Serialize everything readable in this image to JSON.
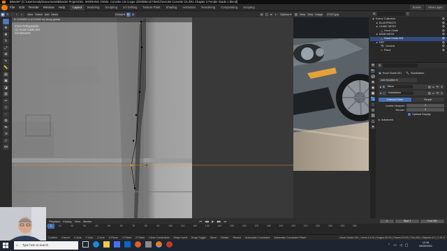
{
  "window": {
    "title": "Blender* [C:\\Users\\Andy\\Documents\\Blender Projects\\01. WORKING ON\\25. Corvette C6 Coupe 2004\\Blend Files\\Chevrolet Corvette C6 ZR1 Chapter 3 Fender Guide A.blend]"
  },
  "menubar": {
    "menus": [
      "File",
      "Edit",
      "Render",
      "Window",
      "Help"
    ],
    "workspaces": [
      "Layout",
      "Modeling",
      "Sculpting",
      "UV Editing",
      "Texture Paint",
      "Shading",
      "Animation",
      "Rendering",
      "Compositing",
      "Scripting"
    ],
    "active_workspace": "Layout",
    "scene": "Scene",
    "view_layer": "View Layer"
  },
  "viewport": {
    "view_name": "Front Orthographic",
    "object_name": "(1) Hood Guide.001",
    "units": "Centimeters",
    "transform_orientation": "Global",
    "options_label": "Options",
    "stats": "D: 0.03482 m (0.03482 m) along global"
  },
  "image_editor": {
    "header_items": [
      "View",
      "View",
      "Image"
    ],
    "image_name": "27247.jpg",
    "image_name_bottom": "27246.jpg"
  },
  "outliner": {
    "items": [
      {
        "label": "Scene Collection",
        "depth": 0,
        "selected": false
      },
      {
        "label": "BLUEPRINTS",
        "depth": 1,
        "selected": false
      },
      {
        "label": "GUIDE MESH",
        "depth": 1,
        "selected": false
      },
      {
        "label": "Hood Guide",
        "depth": 2,
        "selected": false
      },
      {
        "label": "MAIN MESH",
        "depth": 1,
        "selected": false
      },
      {
        "label": "Hood Guide.001",
        "depth": 2,
        "selected": true
      },
      {
        "label": "REF",
        "depth": 1,
        "selected": false
      },
      {
        "label": "Camera",
        "depth": 2,
        "selected": false
      },
      {
        "label": "Plane",
        "depth": 2,
        "selected": false
      }
    ]
  },
  "properties": {
    "object_name": "Hood Guide.001",
    "modifier_context": "Subdivision",
    "add_modifier": "Add Modifier",
    "modifiers": [
      "Mirror",
      "Subdivision"
    ],
    "catmull_clark": "Catmull-Clark",
    "simple": "Simple",
    "levels_viewport_label": "Levels Viewport",
    "levels_viewport_value": "1",
    "render_label": "Render",
    "render_value": "2",
    "optimal_display": "Optimal Display",
    "advanced": "Advanced"
  },
  "timeline": {
    "menus": [
      "Playback",
      "Keying",
      "View",
      "Marker"
    ],
    "current_frame": "1",
    "start_label": "Start",
    "start_value": "1",
    "end_label": "End",
    "end_value": "250",
    "ticks": [
      "0",
      "10",
      "20",
      "30",
      "40",
      "50",
      "60",
      "70",
      "80",
      "90",
      "100",
      "110",
      "120",
      "130",
      "140",
      "150",
      "160",
      "170",
      "180",
      "190",
      "200",
      "210",
      "220",
      "230",
      "240",
      "250"
    ]
  },
  "statusbar": {
    "items": [
      "Confirm",
      "Cancel",
      "X Axis",
      "Y Axis",
      "Z Axis",
      "X Plane",
      "Y Plane",
      "Z Plane",
      "Clear Constraints",
      "Snap Invert",
      "Snap Toggle",
      "Move",
      "Rotate",
      "Resize",
      "Automatic Constraint",
      "Automatic Constraint Plane"
    ],
    "stats": "Hood Guide.001 | Verts:1/143 | Edges:0/276 | Faces:0/133 | Tris:264 | Objects:1/7 | 2.91.0"
  },
  "taskbar": {
    "search_placeholder": "Type here to search",
    "time": "12:16",
    "date": "28/05/2021"
  },
  "colors": {
    "accent": "#4772b3",
    "selection_orange": "#f08c1e",
    "selected_row": "#334d80"
  }
}
